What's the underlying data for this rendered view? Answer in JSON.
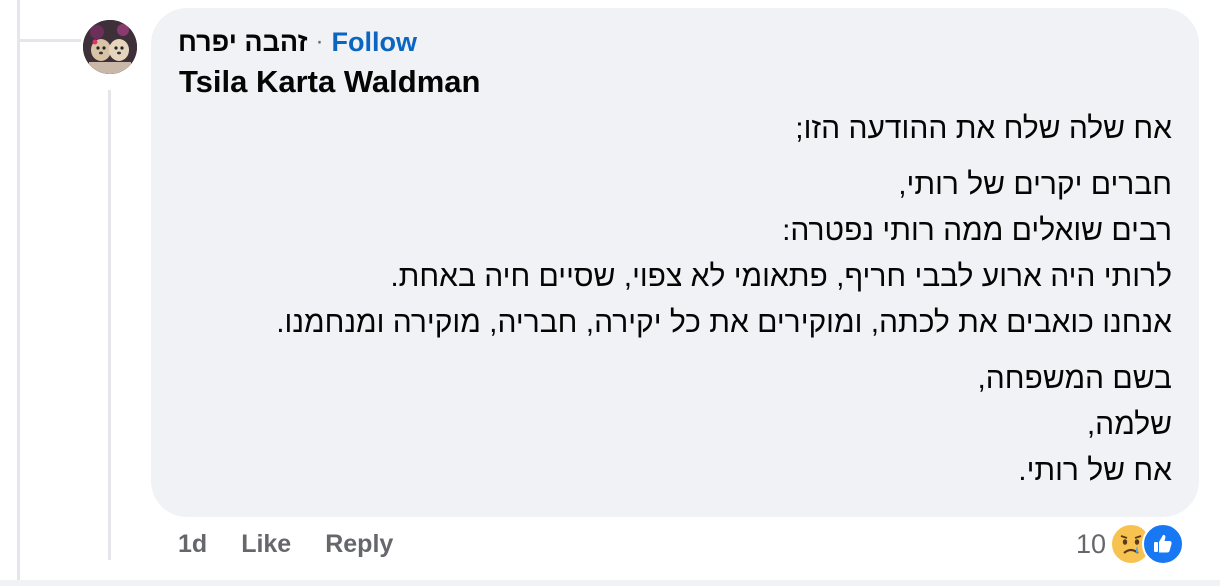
{
  "comment": {
    "author": "זהבה יפרח",
    "separator": "·",
    "follow_label": "Follow",
    "subname": "Tsila Karta Waldman",
    "paragraphs": [
      [
        "אח שלה שלח את ההודעה הזו;"
      ],
      [
        "חברים יקרים של רותי,",
        "רבים שואלים ממה רותי נפטרה:",
        "לרותי היה ארוע לבבי חריף, פתאומי לא צפוי, שסיים חיה באחת.",
        "אנחנו כואבים את לכתה, ומוקירים את כל יקירה, חבריה, מוקירה ומנחמנו."
      ],
      [
        "בשם המשפחה,",
        "שלמה,",
        "אח של רותי."
      ]
    ]
  },
  "actions": {
    "time": "1d",
    "like_label": "Like",
    "reply_label": "Reply"
  },
  "reactions": {
    "count": "10",
    "icons": [
      "like-icon",
      "sad-emoji-icon"
    ]
  },
  "colors": {
    "bubble": "#f0f2f5",
    "follow": "#0b66c2",
    "meta": "#65676b",
    "like_blue": "#1877f2"
  }
}
